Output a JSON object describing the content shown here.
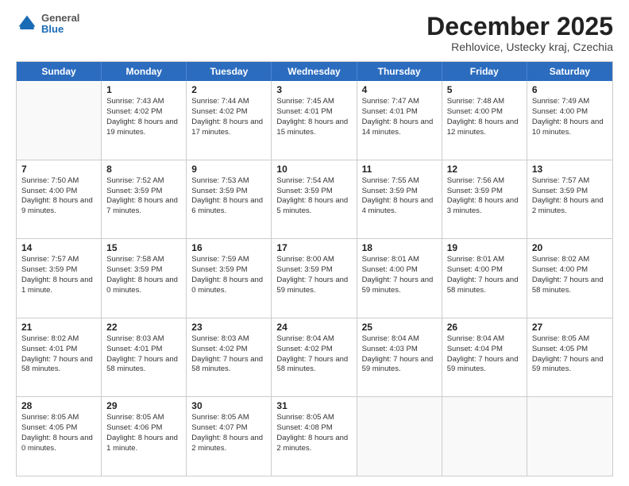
{
  "header": {
    "logo": {
      "general": "General",
      "blue": "Blue"
    },
    "title": "December 2025",
    "subtitle": "Rehlovice, Ustecky kraj, Czechia"
  },
  "weekdays": [
    "Sunday",
    "Monday",
    "Tuesday",
    "Wednesday",
    "Thursday",
    "Friday",
    "Saturday"
  ],
  "weeks": [
    [
      {
        "day": null,
        "info": null
      },
      {
        "day": "1",
        "info": "Sunrise: 7:43 AM\nSunset: 4:02 PM\nDaylight: 8 hours\nand 19 minutes."
      },
      {
        "day": "2",
        "info": "Sunrise: 7:44 AM\nSunset: 4:02 PM\nDaylight: 8 hours\nand 17 minutes."
      },
      {
        "day": "3",
        "info": "Sunrise: 7:45 AM\nSunset: 4:01 PM\nDaylight: 8 hours\nand 15 minutes."
      },
      {
        "day": "4",
        "info": "Sunrise: 7:47 AM\nSunset: 4:01 PM\nDaylight: 8 hours\nand 14 minutes."
      },
      {
        "day": "5",
        "info": "Sunrise: 7:48 AM\nSunset: 4:00 PM\nDaylight: 8 hours\nand 12 minutes."
      },
      {
        "day": "6",
        "info": "Sunrise: 7:49 AM\nSunset: 4:00 PM\nDaylight: 8 hours\nand 10 minutes."
      }
    ],
    [
      {
        "day": "7",
        "info": "Sunrise: 7:50 AM\nSunset: 4:00 PM\nDaylight: 8 hours\nand 9 minutes."
      },
      {
        "day": "8",
        "info": "Sunrise: 7:52 AM\nSunset: 3:59 PM\nDaylight: 8 hours\nand 7 minutes."
      },
      {
        "day": "9",
        "info": "Sunrise: 7:53 AM\nSunset: 3:59 PM\nDaylight: 8 hours\nand 6 minutes."
      },
      {
        "day": "10",
        "info": "Sunrise: 7:54 AM\nSunset: 3:59 PM\nDaylight: 8 hours\nand 5 minutes."
      },
      {
        "day": "11",
        "info": "Sunrise: 7:55 AM\nSunset: 3:59 PM\nDaylight: 8 hours\nand 4 minutes."
      },
      {
        "day": "12",
        "info": "Sunrise: 7:56 AM\nSunset: 3:59 PM\nDaylight: 8 hours\nand 3 minutes."
      },
      {
        "day": "13",
        "info": "Sunrise: 7:57 AM\nSunset: 3:59 PM\nDaylight: 8 hours\nand 2 minutes."
      }
    ],
    [
      {
        "day": "14",
        "info": "Sunrise: 7:57 AM\nSunset: 3:59 PM\nDaylight: 8 hours\nand 1 minute."
      },
      {
        "day": "15",
        "info": "Sunrise: 7:58 AM\nSunset: 3:59 PM\nDaylight: 8 hours\nand 0 minutes."
      },
      {
        "day": "16",
        "info": "Sunrise: 7:59 AM\nSunset: 3:59 PM\nDaylight: 8 hours\nand 0 minutes."
      },
      {
        "day": "17",
        "info": "Sunrise: 8:00 AM\nSunset: 3:59 PM\nDaylight: 7 hours\nand 59 minutes."
      },
      {
        "day": "18",
        "info": "Sunrise: 8:01 AM\nSunset: 4:00 PM\nDaylight: 7 hours\nand 59 minutes."
      },
      {
        "day": "19",
        "info": "Sunrise: 8:01 AM\nSunset: 4:00 PM\nDaylight: 7 hours\nand 58 minutes."
      },
      {
        "day": "20",
        "info": "Sunrise: 8:02 AM\nSunset: 4:00 PM\nDaylight: 7 hours\nand 58 minutes."
      }
    ],
    [
      {
        "day": "21",
        "info": "Sunrise: 8:02 AM\nSunset: 4:01 PM\nDaylight: 7 hours\nand 58 minutes."
      },
      {
        "day": "22",
        "info": "Sunrise: 8:03 AM\nSunset: 4:01 PM\nDaylight: 7 hours\nand 58 minutes."
      },
      {
        "day": "23",
        "info": "Sunrise: 8:03 AM\nSunset: 4:02 PM\nDaylight: 7 hours\nand 58 minutes."
      },
      {
        "day": "24",
        "info": "Sunrise: 8:04 AM\nSunset: 4:02 PM\nDaylight: 7 hours\nand 58 minutes."
      },
      {
        "day": "25",
        "info": "Sunrise: 8:04 AM\nSunset: 4:03 PM\nDaylight: 7 hours\nand 59 minutes."
      },
      {
        "day": "26",
        "info": "Sunrise: 8:04 AM\nSunset: 4:04 PM\nDaylight: 7 hours\nand 59 minutes."
      },
      {
        "day": "27",
        "info": "Sunrise: 8:05 AM\nSunset: 4:05 PM\nDaylight: 7 hours\nand 59 minutes."
      }
    ],
    [
      {
        "day": "28",
        "info": "Sunrise: 8:05 AM\nSunset: 4:05 PM\nDaylight: 8 hours\nand 0 minutes."
      },
      {
        "day": "29",
        "info": "Sunrise: 8:05 AM\nSunset: 4:06 PM\nDaylight: 8 hours\nand 1 minute."
      },
      {
        "day": "30",
        "info": "Sunrise: 8:05 AM\nSunset: 4:07 PM\nDaylight: 8 hours\nand 2 minutes."
      },
      {
        "day": "31",
        "info": "Sunrise: 8:05 AM\nSunset: 4:08 PM\nDaylight: 8 hours\nand 2 minutes."
      },
      {
        "day": null,
        "info": null
      },
      {
        "day": null,
        "info": null
      },
      {
        "day": null,
        "info": null
      }
    ]
  ]
}
